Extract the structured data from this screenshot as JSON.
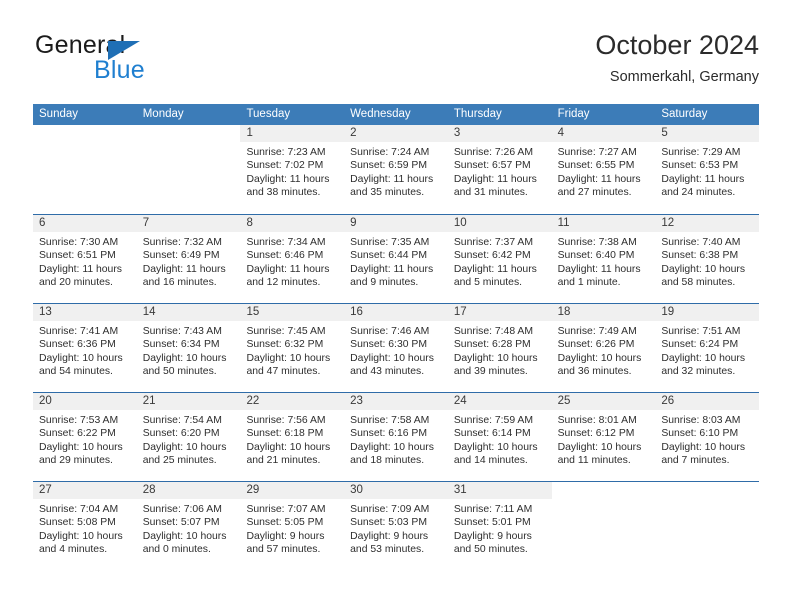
{
  "brand": {
    "name_top": "General",
    "name_bottom": "Blue",
    "accent_color": "#1f7fd0",
    "triangle_color": "#1f6fb5"
  },
  "header": {
    "title": "October 2024",
    "subtitle": "Sommerkahl, Germany"
  },
  "theme": {
    "header_bg": "#3c7cb8",
    "header_text": "#ffffff",
    "week_separator": "#2f6ca8",
    "daynum_band_bg": "#f0f0f0"
  },
  "weekdays": [
    "Sunday",
    "Monday",
    "Tuesday",
    "Wednesday",
    "Thursday",
    "Friday",
    "Saturday"
  ],
  "labels": {
    "sunrise_prefix": "Sunrise: ",
    "sunset_prefix": "Sunset: ",
    "daylight_prefix": "Daylight: "
  },
  "weeks": [
    [
      {
        "day": "",
        "blank": true
      },
      {
        "day": "",
        "blank": true
      },
      {
        "day": "1",
        "sunrise": "Sunrise: 7:23 AM",
        "sunset": "Sunset: 7:02 PM",
        "daylight": "Daylight: 11 hours and 38 minutes."
      },
      {
        "day": "2",
        "sunrise": "Sunrise: 7:24 AM",
        "sunset": "Sunset: 6:59 PM",
        "daylight": "Daylight: 11 hours and 35 minutes."
      },
      {
        "day": "3",
        "sunrise": "Sunrise: 7:26 AM",
        "sunset": "Sunset: 6:57 PM",
        "daylight": "Daylight: 11 hours and 31 minutes."
      },
      {
        "day": "4",
        "sunrise": "Sunrise: 7:27 AM",
        "sunset": "Sunset: 6:55 PM",
        "daylight": "Daylight: 11 hours and 27 minutes."
      },
      {
        "day": "5",
        "sunrise": "Sunrise: 7:29 AM",
        "sunset": "Sunset: 6:53 PM",
        "daylight": "Daylight: 11 hours and 24 minutes."
      }
    ],
    [
      {
        "day": "6",
        "sunrise": "Sunrise: 7:30 AM",
        "sunset": "Sunset: 6:51 PM",
        "daylight": "Daylight: 11 hours and 20 minutes."
      },
      {
        "day": "7",
        "sunrise": "Sunrise: 7:32 AM",
        "sunset": "Sunset: 6:49 PM",
        "daylight": "Daylight: 11 hours and 16 minutes."
      },
      {
        "day": "8",
        "sunrise": "Sunrise: 7:34 AM",
        "sunset": "Sunset: 6:46 PM",
        "daylight": "Daylight: 11 hours and 12 minutes."
      },
      {
        "day": "9",
        "sunrise": "Sunrise: 7:35 AM",
        "sunset": "Sunset: 6:44 PM",
        "daylight": "Daylight: 11 hours and 9 minutes."
      },
      {
        "day": "10",
        "sunrise": "Sunrise: 7:37 AM",
        "sunset": "Sunset: 6:42 PM",
        "daylight": "Daylight: 11 hours and 5 minutes."
      },
      {
        "day": "11",
        "sunrise": "Sunrise: 7:38 AM",
        "sunset": "Sunset: 6:40 PM",
        "daylight": "Daylight: 11 hours and 1 minute."
      },
      {
        "day": "12",
        "sunrise": "Sunrise: 7:40 AM",
        "sunset": "Sunset: 6:38 PM",
        "daylight": "Daylight: 10 hours and 58 minutes."
      }
    ],
    [
      {
        "day": "13",
        "sunrise": "Sunrise: 7:41 AM",
        "sunset": "Sunset: 6:36 PM",
        "daylight": "Daylight: 10 hours and 54 minutes."
      },
      {
        "day": "14",
        "sunrise": "Sunrise: 7:43 AM",
        "sunset": "Sunset: 6:34 PM",
        "daylight": "Daylight: 10 hours and 50 minutes."
      },
      {
        "day": "15",
        "sunrise": "Sunrise: 7:45 AM",
        "sunset": "Sunset: 6:32 PM",
        "daylight": "Daylight: 10 hours and 47 minutes."
      },
      {
        "day": "16",
        "sunrise": "Sunrise: 7:46 AM",
        "sunset": "Sunset: 6:30 PM",
        "daylight": "Daylight: 10 hours and 43 minutes."
      },
      {
        "day": "17",
        "sunrise": "Sunrise: 7:48 AM",
        "sunset": "Sunset: 6:28 PM",
        "daylight": "Daylight: 10 hours and 39 minutes."
      },
      {
        "day": "18",
        "sunrise": "Sunrise: 7:49 AM",
        "sunset": "Sunset: 6:26 PM",
        "daylight": "Daylight: 10 hours and 36 minutes."
      },
      {
        "day": "19",
        "sunrise": "Sunrise: 7:51 AM",
        "sunset": "Sunset: 6:24 PM",
        "daylight": "Daylight: 10 hours and 32 minutes."
      }
    ],
    [
      {
        "day": "20",
        "sunrise": "Sunrise: 7:53 AM",
        "sunset": "Sunset: 6:22 PM",
        "daylight": "Daylight: 10 hours and 29 minutes."
      },
      {
        "day": "21",
        "sunrise": "Sunrise: 7:54 AM",
        "sunset": "Sunset: 6:20 PM",
        "daylight": "Daylight: 10 hours and 25 minutes."
      },
      {
        "day": "22",
        "sunrise": "Sunrise: 7:56 AM",
        "sunset": "Sunset: 6:18 PM",
        "daylight": "Daylight: 10 hours and 21 minutes."
      },
      {
        "day": "23",
        "sunrise": "Sunrise: 7:58 AM",
        "sunset": "Sunset: 6:16 PM",
        "daylight": "Daylight: 10 hours and 18 minutes."
      },
      {
        "day": "24",
        "sunrise": "Sunrise: 7:59 AM",
        "sunset": "Sunset: 6:14 PM",
        "daylight": "Daylight: 10 hours and 14 minutes."
      },
      {
        "day": "25",
        "sunrise": "Sunrise: 8:01 AM",
        "sunset": "Sunset: 6:12 PM",
        "daylight": "Daylight: 10 hours and 11 minutes."
      },
      {
        "day": "26",
        "sunrise": "Sunrise: 8:03 AM",
        "sunset": "Sunset: 6:10 PM",
        "daylight": "Daylight: 10 hours and 7 minutes."
      }
    ],
    [
      {
        "day": "27",
        "sunrise": "Sunrise: 7:04 AM",
        "sunset": "Sunset: 5:08 PM",
        "daylight": "Daylight: 10 hours and 4 minutes."
      },
      {
        "day": "28",
        "sunrise": "Sunrise: 7:06 AM",
        "sunset": "Sunset: 5:07 PM",
        "daylight": "Daylight: 10 hours and 0 minutes."
      },
      {
        "day": "29",
        "sunrise": "Sunrise: 7:07 AM",
        "sunset": "Sunset: 5:05 PM",
        "daylight": "Daylight: 9 hours and 57 minutes."
      },
      {
        "day": "30",
        "sunrise": "Sunrise: 7:09 AM",
        "sunset": "Sunset: 5:03 PM",
        "daylight": "Daylight: 9 hours and 53 minutes."
      },
      {
        "day": "31",
        "sunrise": "Sunrise: 7:11 AM",
        "sunset": "Sunset: 5:01 PM",
        "daylight": "Daylight: 9 hours and 50 minutes."
      },
      {
        "day": "",
        "blank": true
      },
      {
        "day": "",
        "blank": true
      }
    ]
  ]
}
